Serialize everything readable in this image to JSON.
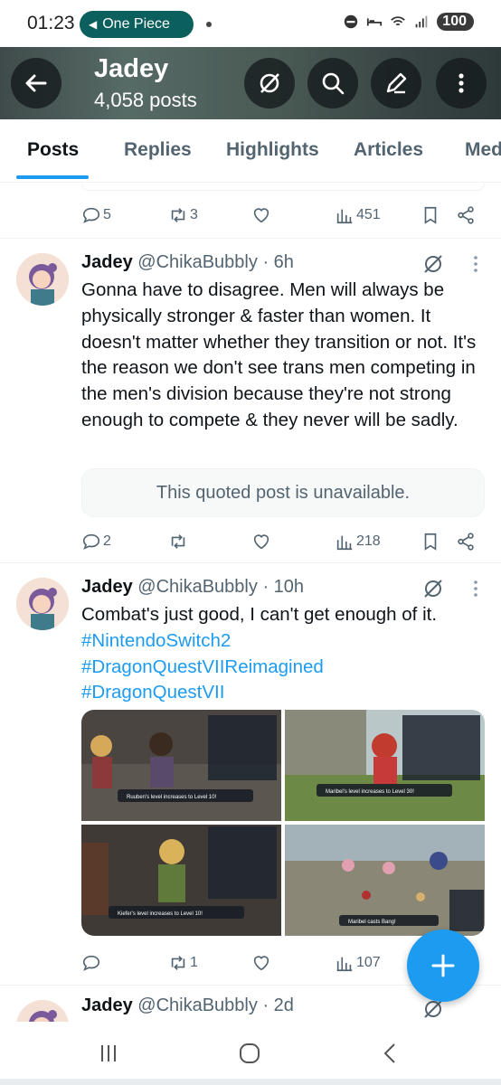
{
  "status_bar": {
    "time": "01:23",
    "media_title": "One Piece",
    "battery": "100"
  },
  "header": {
    "name": "Jadey",
    "post_count": "4,058 posts"
  },
  "tabs": [
    {
      "label": "Posts",
      "active": true
    },
    {
      "label": "Replies",
      "active": false
    },
    {
      "label": "Highlights",
      "active": false
    },
    {
      "label": "Articles",
      "active": false
    },
    {
      "label": "Med",
      "active": false
    }
  ],
  "tweets": [
    {
      "partial": true,
      "replies": "5",
      "reposts": "3",
      "views": "451"
    },
    {
      "name": "Jadey",
      "handle": "@ChikaBubbly",
      "time": "· 6h",
      "text": "Gonna have to disagree. Men will always be physically stronger & faster than women. It doesn't matter whether they transition or not. It's the reason we don't see trans men competing in the men's division because they're not strong enough to compete & they never will be sadly.",
      "quote": "This quoted post is unavailable.",
      "replies": "2",
      "reposts": "",
      "views": "218"
    },
    {
      "name": "Jadey",
      "handle": "@ChikaBubbly",
      "time": "· 10h",
      "text": "Combat's just good, I can't get enough of it.",
      "hashtags": [
        "#NintendoSwitch2",
        "#DragonQuestVIIReimagined",
        "#DragonQuestVII"
      ],
      "media_captions": [
        "Ruuben's level increases to Level 10!",
        "Maribel's level increases to Level 30!",
        "Kiefer's level increases to Level 10!",
        "Maribel casts Bang!"
      ],
      "replies": "",
      "reposts": "1",
      "views": "107"
    },
    {
      "name": "Jadey",
      "handle": "@ChikaBubbly",
      "time": "· 2d"
    }
  ],
  "colors": {
    "accent": "#1d9bf0",
    "text": "#0f1419",
    "muted": "#536471"
  }
}
